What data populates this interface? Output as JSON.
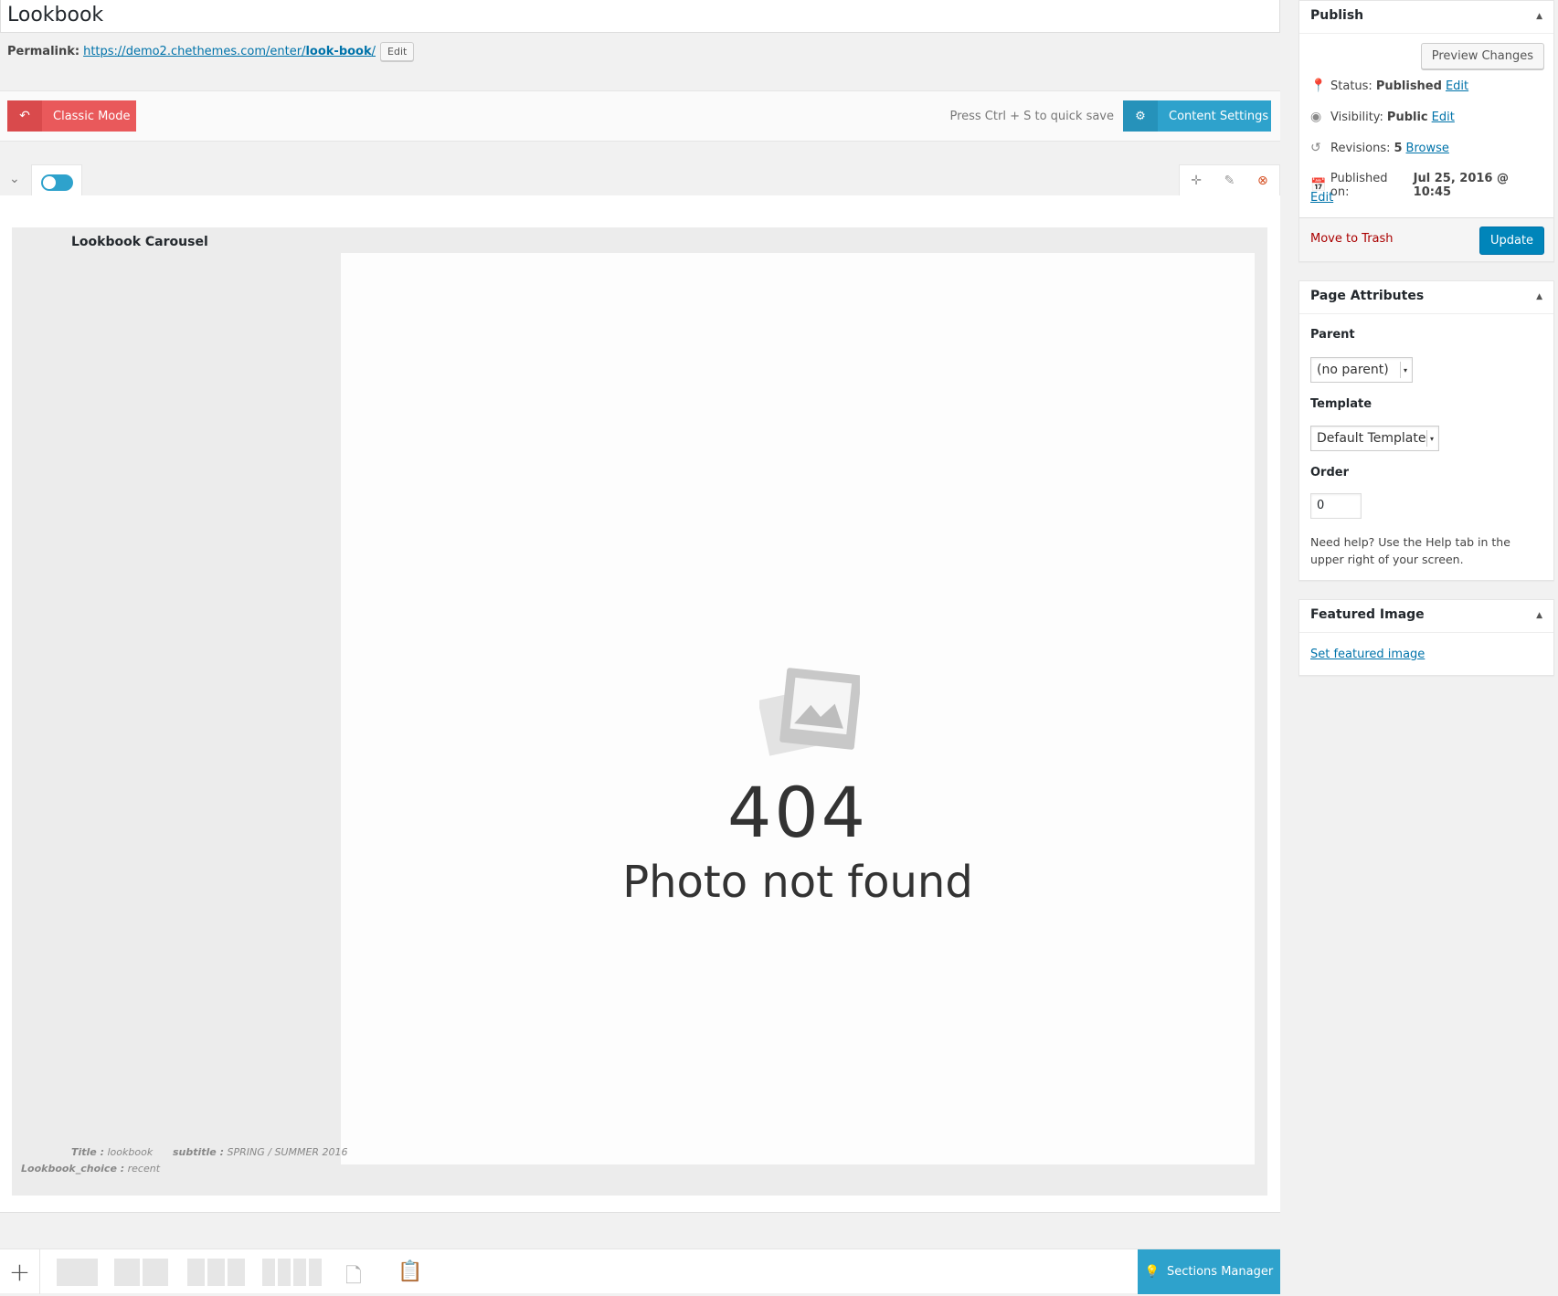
{
  "title": "Lookbook",
  "permalink": {
    "label": "Permalink:",
    "url_prefix": "https://demo2.chethemes.com/enter/",
    "slug": "look-book",
    "url_suffix": "/",
    "edit_label": "Edit"
  },
  "toolbar": {
    "classic_mode_label": "Classic Mode",
    "quick_save_hint": "Press Ctrl + S to quick save",
    "content_settings_label": "Content Settings"
  },
  "element": {
    "title": "Lookbook Carousel",
    "not_found_code": "404",
    "not_found_text": "Photo not found",
    "params": {
      "title_label": "Title :",
      "title_value": "lookbook",
      "subtitle_label": "subtitle :",
      "subtitle_value": "SPRING / SUMMER 2016",
      "choice_label": "Lookbook_choice :",
      "choice_value": "recent"
    }
  },
  "bottom": {
    "sections_manager_label": "Sections Manager"
  },
  "publish": {
    "heading": "Publish",
    "preview_label": "Preview Changes",
    "status_label": "Status:",
    "status_value": "Published",
    "status_edit": "Edit",
    "visibility_label": "Visibility:",
    "visibility_value": "Public",
    "visibility_edit": "Edit",
    "revisions_label": "Revisions:",
    "revisions_value": "5",
    "revisions_browse": "Browse",
    "published_label": "Published on:",
    "published_value": "Jul 25, 2016 @ 10:45",
    "published_edit": "Edit",
    "trash_label": "Move to Trash",
    "update_label": "Update"
  },
  "attributes": {
    "heading": "Page Attributes",
    "parent_label": "Parent",
    "parent_value": "(no parent)",
    "template_label": "Template",
    "template_value": "Default Template",
    "order_label": "Order",
    "order_value": "0",
    "help_text": "Need help? Use the Help tab in the upper right of your screen."
  },
  "featured": {
    "heading": "Featured Image",
    "link_label": "Set featured image"
  },
  "colors": {
    "classic_mode": "#e9595b",
    "accent_blue": "#2ea2cc",
    "update_button": "#0085ba",
    "trash_red": "#a00"
  }
}
